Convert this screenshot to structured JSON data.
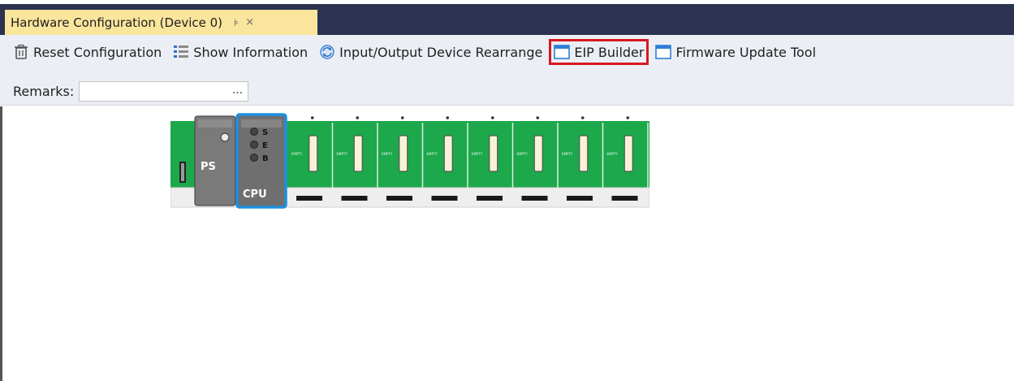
{
  "document_tab": {
    "title": "Hardware Configuration (Device 0)",
    "pin_icon": "pin-icon",
    "close_icon": "close-icon",
    "pin_glyph": "⊧",
    "close_glyph": "×"
  },
  "toolbar": {
    "items": [
      {
        "label": "Reset Configuration",
        "icon": "trash-icon"
      },
      {
        "label": "Show Information",
        "icon": "list-icon"
      },
      {
        "label": "Input/Output Device Rearrange",
        "icon": "refresh-icon"
      },
      {
        "label": "EIP Builder",
        "icon": "window-icon",
        "highlighted": true
      },
      {
        "label": "Firmware Update Tool",
        "icon": "window-icon"
      }
    ],
    "highlight_color": "#d71920"
  },
  "remarks": {
    "label": "Remarks:",
    "value": "",
    "browse_label": "..."
  },
  "rack": {
    "power_supply_label": "PS",
    "cpu_label": "CPU",
    "cpu_leds": [
      "S",
      "E",
      "B"
    ],
    "io_slot_count": 8,
    "io_slot_label": "EMPTY",
    "colors": {
      "rack_green": "#1ca84b",
      "module_gray": "#7a7a7a",
      "cpu_border": "#1e8fe0"
    }
  }
}
